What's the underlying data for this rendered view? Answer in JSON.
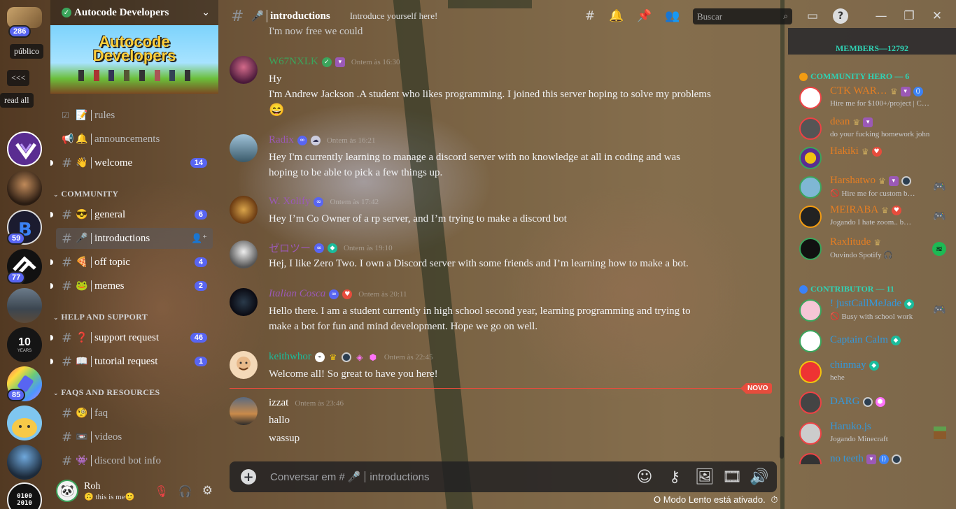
{
  "rail": {
    "top_count": "286",
    "publico_label": "público",
    "collapse_label": "<<<",
    "readall_label": "read all",
    "server_badges": [
      "59",
      "77",
      "85"
    ],
    "server_10_years": "10",
    "server_10_sub": "YEARS",
    "bottom_server_text": "0100\n2010"
  },
  "sidebar": {
    "server_name": "Autocode Developers",
    "banner_title_1": "Autocode",
    "banner_title_2": "Developers",
    "channels_top": [
      {
        "emoji": "📝",
        "name": "rules"
      },
      {
        "emoji": "🔔",
        "name": "announcements"
      },
      {
        "emoji": "👋",
        "name": "welcome",
        "count": "14"
      }
    ],
    "category_community": "COMMUNITY",
    "channels_community": [
      {
        "emoji": "😎",
        "name": "general",
        "count": "6"
      },
      {
        "emoji": "🎤",
        "name": "introductions"
      },
      {
        "emoji": "🍕",
        "name": "off topic",
        "count": "4"
      },
      {
        "emoji": "🐸",
        "name": "memes",
        "count": "2"
      }
    ],
    "category_help": "HELP AND SUPPORT",
    "channels_help": [
      {
        "emoji": "❓",
        "name": "support request",
        "count": "46"
      },
      {
        "emoji": "📖",
        "name": "tutorial request",
        "count": "1"
      }
    ],
    "category_faqs": "FAQS AND RESOURCES",
    "channels_faqs": [
      {
        "emoji": "🧐",
        "name": "faq"
      },
      {
        "emoji": "📼",
        "name": "videos"
      },
      {
        "emoji": "👾",
        "name": "discord bot info"
      }
    ],
    "user": {
      "name": "Roh",
      "status": "🙃 this is me🙂"
    }
  },
  "header": {
    "channel_emoji": "🎤",
    "channel_name": "introductions",
    "topic": "Introduce yourself here!",
    "search_placeholder": "Buscar"
  },
  "messages": [
    {
      "author": "",
      "time": "",
      "lines": [
        "I'm now free we could"
      ]
    },
    {
      "author": "W67NXLK",
      "time": "Ontem às 16:30",
      "color": "#3ba55c",
      "lines": [
        "Hy",
        "I'm Andrew Jackson .A student who likes programming. I joined this server hoping to solve my problems",
        "😄"
      ]
    },
    {
      "author": "Radix",
      "time": "Ontem às 16:21",
      "color": "#9b59b6",
      "lines": [
        "Hey I'm currently learning to manage a discord server with no knowledge at all in coding and was",
        "hoping to be able to pick a few things up."
      ]
    },
    {
      "author": "W. Xolify",
      "time": "Ontem às 17:42",
      "color": "#9b59b6",
      "lines": [
        "Hey I’m Co Owner of a rp server, and I’m trying to make a discord bot"
      ]
    },
    {
      "author": "ゼロツー",
      "time": "Ontem às 19:10",
      "color": "#9b59b6",
      "lines": [
        "Hej, I like Zero Two. I own a Discord server with some friends and I’m learning how to make a bot."
      ]
    },
    {
      "author": "Italian Cosca",
      "time": "Ontem às 20:11",
      "color": "#9b59b6",
      "lines": [
        "Hello there. I am a student currently in high school second year, learning programming and trying to",
        "make a bot for fun and mind development. Hope we go on well."
      ]
    },
    {
      "author": "keithwhor",
      "time": "Ontem às 22:45",
      "color": "#1abc9c",
      "lines": [
        "Welcome all! So great to have you here!"
      ]
    },
    {
      "author": "izzat",
      "time": "Ontem às 23:46",
      "color": "#ffffff",
      "lines": [
        "hallo",
        "",
        "wassup"
      ]
    }
  ],
  "new_marker": "NOVO",
  "composer": {
    "placeholder_prefix": "Conversar em #",
    "placeholder_emoji": "🎤",
    "placeholder_channel": "introductions"
  },
  "slowmode_text": "O Modo Lento está ativado.",
  "members": {
    "header": "MEMBERS—12792",
    "roles": [
      {
        "title": "COMMUNITY HERO — 6",
        "color": "#2fd3b5",
        "users": [
          {
            "name": "CTK WAR…",
            "status": "Hire me for $100+/project | C…",
            "color": "#e67e22"
          },
          {
            "name": "dean",
            "status": "do your fucking homework john",
            "color": "#e67e22"
          },
          {
            "name": "Hakiki",
            "status": "",
            "color": "#e67e22"
          },
          {
            "name": "Harshatwo",
            "status": "🚫 Hire me for custom b…",
            "color": "#e67e22"
          },
          {
            "name": "MEIRABA",
            "status": "Jogando I hate zoom.. b…",
            "color": "#e67e22"
          },
          {
            "name": "Raxlitude",
            "status": "Ouvindo Spotify 🎧",
            "color": "#e67e22"
          }
        ]
      },
      {
        "title": "CONTRIBUTOR — 11",
        "color": "#2fd3b5",
        "users": [
          {
            "name": "! justCallMeJade",
            "status": "🚫 Busy with school work",
            "color": "#3498db"
          },
          {
            "name": "Captain Calm",
            "status": "",
            "color": "#3498db"
          },
          {
            "name": "chinmay",
            "status": "hehe",
            "color": "#3498db"
          },
          {
            "name": "DARG",
            "status": "",
            "color": "#3498db"
          },
          {
            "name": "Haruko.js",
            "status": "Jogando Minecraft",
            "color": "#3498db"
          },
          {
            "name": "no teeth",
            "status": "",
            "color": "#3498db"
          }
        ]
      }
    ]
  },
  "colors": {
    "accent": "#5865f2",
    "new": "#e74c3c",
    "online": "#3ba55c"
  }
}
